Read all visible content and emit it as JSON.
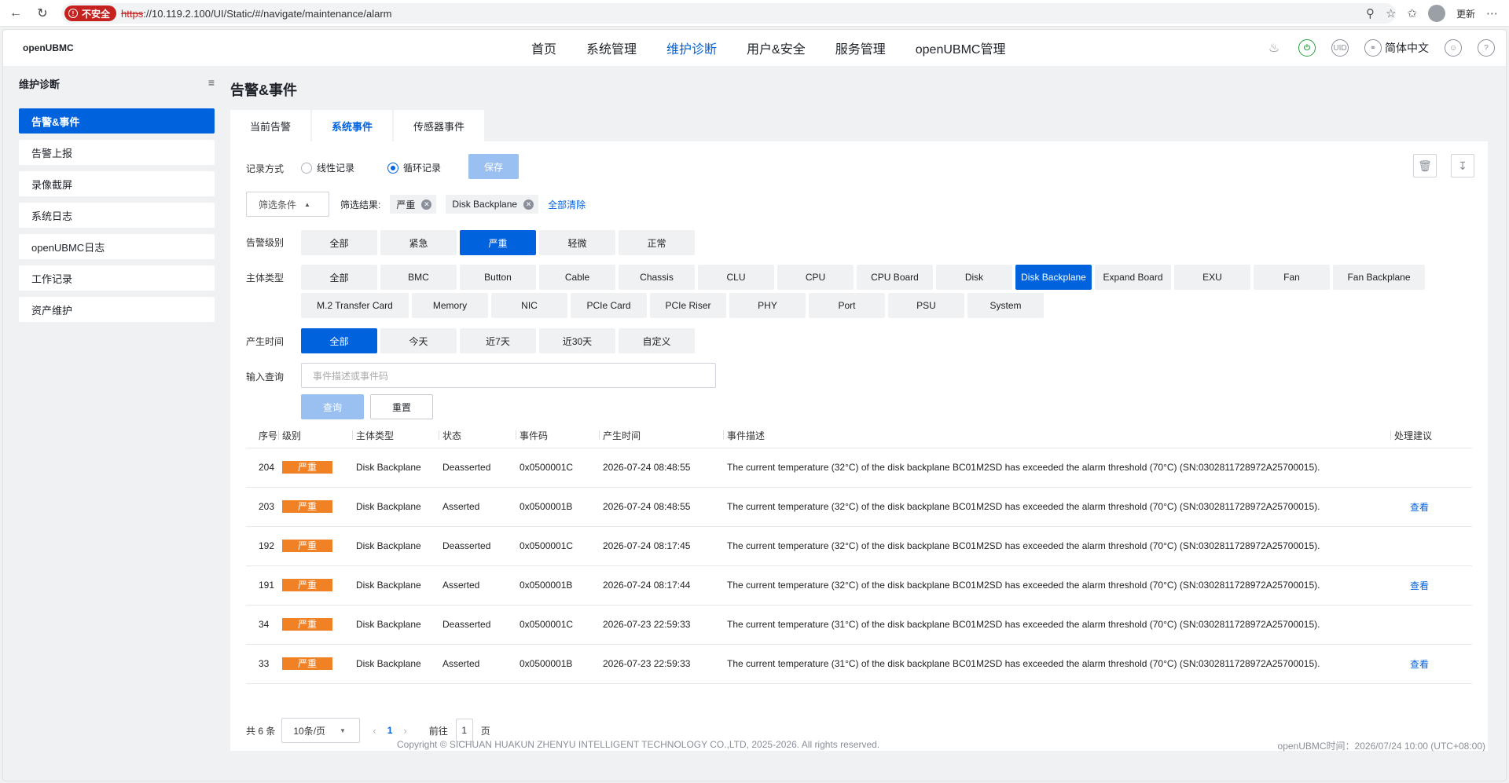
{
  "browser": {
    "insecure_label": "不安全",
    "url_proto": "https",
    "url_rest": "://10.119.2.100/UI/Static/#/navigate/maintenance/alarm",
    "update_label": "更新"
  },
  "header": {
    "logo": "openUBMC",
    "nav": [
      "首页",
      "系统管理",
      "维护诊断",
      "用户&安全",
      "服务管理",
      "openUBMC管理"
    ],
    "active_nav": "维护诊断",
    "uid_label": "UID",
    "language": "简体中文"
  },
  "sidebar": {
    "title": "维护诊断",
    "items": [
      "告警&事件",
      "告警上报",
      "录像截屏",
      "系统日志",
      "openUBMC日志",
      "工作记录",
      "资产维护"
    ]
  },
  "page_title": "告警&事件",
  "tabs": [
    "当前告警",
    "系统事件",
    "传感器事件"
  ],
  "record": {
    "label": "记录方式",
    "options": [
      "线性记录",
      "循环记录"
    ],
    "selected": "循环记录",
    "save_label": "保存"
  },
  "filter": {
    "select_label": "筛选条件",
    "result_label": "筛选结果:",
    "chips": [
      "严重",
      "Disk Backplane"
    ],
    "clear_label": "全部清除"
  },
  "level": {
    "label": "告警级别",
    "options": [
      "全部",
      "紧急",
      "严重",
      "轻微",
      "正常"
    ],
    "selected": "严重"
  },
  "subject": {
    "label": "主体类型",
    "options": [
      "全部",
      "BMC",
      "Button",
      "Cable",
      "Chassis",
      "CLU",
      "CPU",
      "CPU Board",
      "Disk",
      "Disk Backplane",
      "Expand Board",
      "EXU",
      "Fan",
      "Fan Backplane",
      "M.2 Transfer Card",
      "Memory",
      "NIC",
      "PCIe Card",
      "PCIe Riser",
      "PHY",
      "Port",
      "PSU",
      "System"
    ],
    "selected": "Disk Backplane"
  },
  "time": {
    "label": "产生时间",
    "options": [
      "全部",
      "今天",
      "近7天",
      "近30天",
      "自定义"
    ],
    "selected": "全部"
  },
  "query": {
    "label": "输入查询",
    "placeholder": "事件描述或事件码",
    "query_label": "查询",
    "reset_label": "重置"
  },
  "table": {
    "headers": [
      "序号",
      "级别",
      "主体类型",
      "状态",
      "事件码",
      "产生时间",
      "事件描述",
      "处理建议"
    ],
    "rows": [
      {
        "id": "204",
        "level": "严重",
        "subject": "Disk Backplane",
        "state": "Deasserted",
        "code": "0x0500001C",
        "time": "2026-07-24 08:48:55",
        "desc": "The current temperature (32°C) of the disk backplane BC01M2SD has exceeded the alarm threshold (70°C) (SN:0302811728972A25700015).",
        "action": ""
      },
      {
        "id": "203",
        "level": "严重",
        "subject": "Disk Backplane",
        "state": "Asserted",
        "code": "0x0500001B",
        "time": "2026-07-24 08:48:55",
        "desc": "The current temperature (32°C) of the disk backplane BC01M2SD has exceeded the alarm threshold (70°C) (SN:0302811728972A25700015).",
        "action": "查看"
      },
      {
        "id": "192",
        "level": "严重",
        "subject": "Disk Backplane",
        "state": "Deasserted",
        "code": "0x0500001C",
        "time": "2026-07-24 08:17:45",
        "desc": "The current temperature (32°C) of the disk backplane BC01M2SD has exceeded the alarm threshold (70°C) (SN:0302811728972A25700015).",
        "action": ""
      },
      {
        "id": "191",
        "level": "严重",
        "subject": "Disk Backplane",
        "state": "Asserted",
        "code": "0x0500001B",
        "time": "2026-07-24 08:17:44",
        "desc": "The current temperature (32°C) of the disk backplane BC01M2SD has exceeded the alarm threshold (70°C) (SN:0302811728972A25700015).",
        "action": "查看"
      },
      {
        "id": "34",
        "level": "严重",
        "subject": "Disk Backplane",
        "state": "Deasserted",
        "code": "0x0500001C",
        "time": "2026-07-23 22:59:33",
        "desc": "The current temperature (31°C) of the disk backplane BC01M2SD has exceeded the alarm threshold (70°C) (SN:0302811728972A25700015).",
        "action": ""
      },
      {
        "id": "33",
        "level": "严重",
        "subject": "Disk Backplane",
        "state": "Asserted",
        "code": "0x0500001B",
        "time": "2026-07-23 22:59:33",
        "desc": "The current temperature (31°C) of the disk backplane BC01M2SD has exceeded the alarm threshold (70°C) (SN:0302811728972A25700015).",
        "action": "查看"
      }
    ]
  },
  "pagination": {
    "total": "共 6 条",
    "page_size": "10条/页",
    "current": "1",
    "goto_label": "前往",
    "goto_value": "1",
    "page_suffix": "页"
  },
  "footer": {
    "copyright": "Copyright © SICHUAN HUAKUN ZHENYU INTELLIGENT TECHNOLOGY CO.,LTD, 2025-2026. All rights reserved.",
    "systime": "openUBMC时间：2026/07/24 10:00 (UTC+08:00)"
  },
  "colors": {
    "accent": "#0062dc",
    "severity": "#f08124",
    "power": "#22a33a"
  }
}
